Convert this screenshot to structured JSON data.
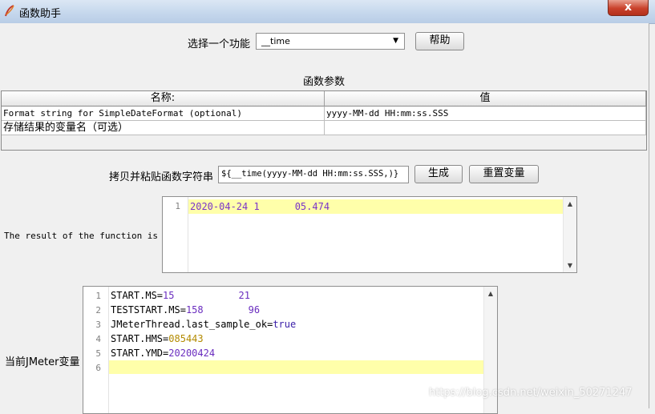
{
  "window": {
    "title": "函数助手",
    "close_label": "x"
  },
  "function_select": {
    "label": "选择一个功能",
    "value": "__time",
    "help_label": "帮助"
  },
  "params": {
    "section_title": "函数参数",
    "headers": {
      "name": "名称:",
      "value": "值"
    },
    "rows": [
      {
        "name": "Format string for SimpleDateFormat (optional)",
        "value": "yyyy-MM-dd HH:mm:ss.SSS"
      },
      {
        "name": "存储结果的变量名（可选）",
        "value": ""
      }
    ]
  },
  "copy_paste": {
    "label": "拷贝并粘贴函数字符串",
    "value": "${__time(yyyy-MM-dd HH:mm:ss.SSS,)}",
    "generate_label": "生成",
    "reset_label": "重置变量"
  },
  "result": {
    "label": "The result of the function is",
    "lines": [
      {
        "num": "1",
        "text_a": "2020-04-24 1",
        "text_b": "05.474"
      }
    ]
  },
  "vars": {
    "label": "当前JMeter变量",
    "lines": [
      {
        "num": "1",
        "key": "START.MS",
        "eq": "=",
        "val": "15",
        "val2": "21"
      },
      {
        "num": "2",
        "key": "TESTSTART.MS",
        "eq": "=",
        "val": "158",
        "val2": "96"
      },
      {
        "num": "3",
        "key": "JMeterThread.last_sample_ok",
        "eq": "=",
        "val": "true",
        "val2": ""
      },
      {
        "num": "4",
        "key": "START.HMS",
        "eq": "=",
        "val": "085443",
        "val2": ""
      },
      {
        "num": "5",
        "key": "START.YMD",
        "eq": "=",
        "val": "20200424",
        "val2": ""
      },
      {
        "num": "6",
        "key": "",
        "eq": "",
        "val": "",
        "val2": ""
      }
    ]
  },
  "watermark": "https://blog.csdn.net/weixin_50271247"
}
